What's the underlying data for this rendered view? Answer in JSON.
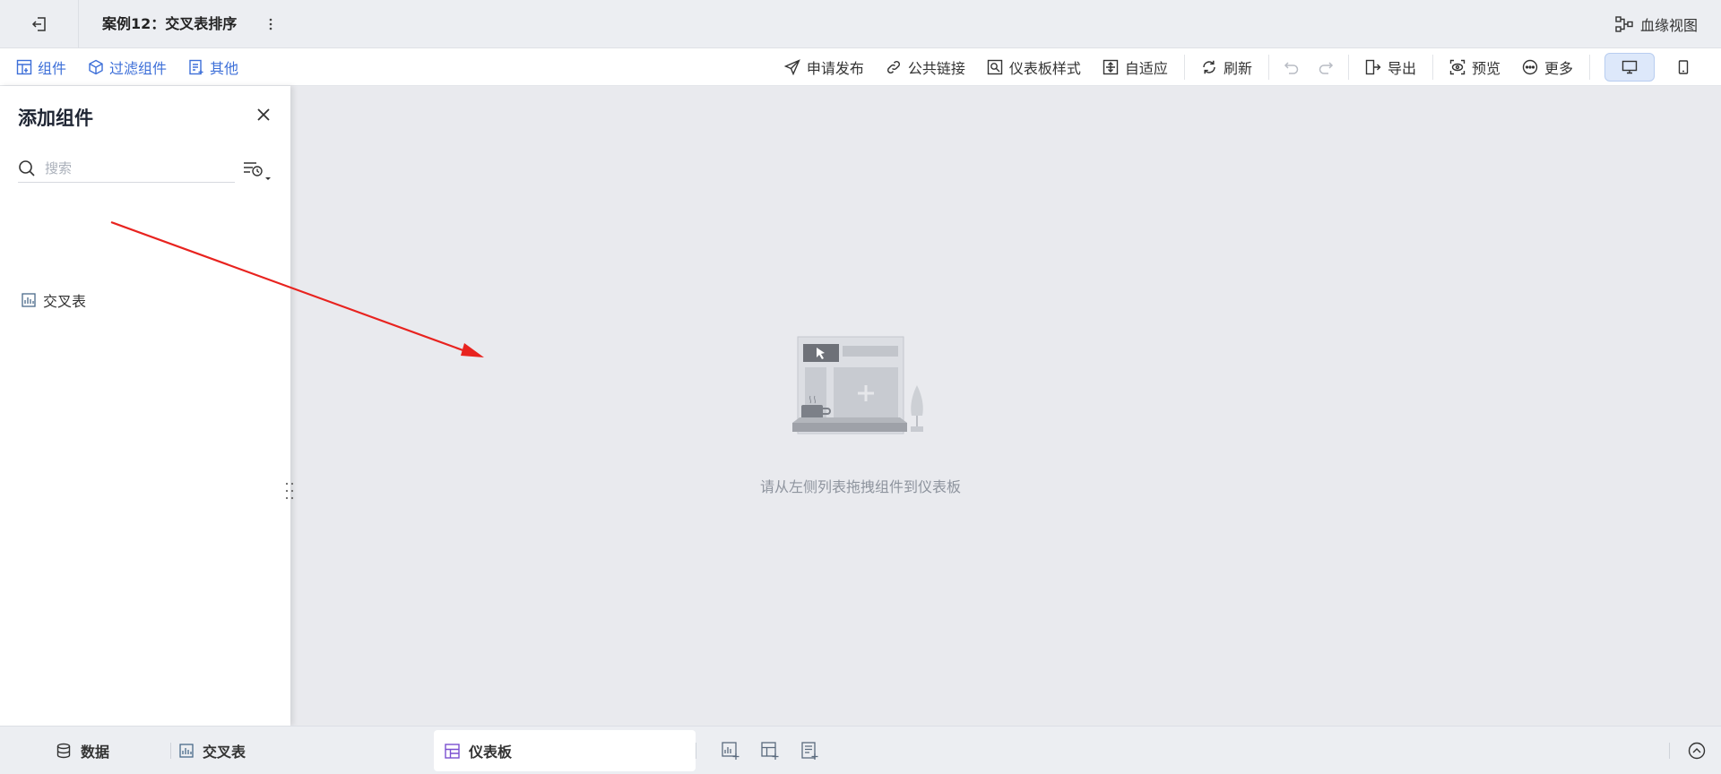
{
  "titlebar": {
    "title": "案例12：交叉表排序",
    "lineage_label": "血缘视图"
  },
  "toolbar": {
    "left_items": [
      "组件",
      "过滤组件",
      "其他"
    ],
    "publish": "申请发布",
    "public_link": "公共链接",
    "dashboard_style": "仪表板样式",
    "adaptive": "自适应",
    "refresh": "刷新",
    "export": "导出",
    "preview": "预览",
    "more": "更多"
  },
  "panel": {
    "title": "添加组件",
    "search_placeholder": "搜索",
    "items": [
      "交叉表"
    ]
  },
  "canvas": {
    "empty_text": "请从左侧列表拖拽组件到仪表板"
  },
  "bottombar": {
    "data_tab": "数据",
    "crosstab_tab": "交叉表",
    "dashboard_tab": "仪表板"
  },
  "colors": {
    "accent": "#3d6fd8",
    "arrow": "#e8231f",
    "canvas_bg": "#e9eaee"
  },
  "icons": [
    "exit-icon",
    "kebab-icon",
    "lineage-icon",
    "component-icon",
    "filter-component-icon",
    "other-icon",
    "send-icon",
    "link-icon",
    "style-icon",
    "adaptive-icon",
    "refresh-icon",
    "undo-icon",
    "redo-icon",
    "export-icon",
    "preview-icon",
    "more-icon",
    "desktop-icon",
    "mobile-icon",
    "close-icon",
    "search-icon",
    "sort-filter-icon",
    "crosstab-icon",
    "database-icon",
    "dashboard-icon",
    "add-crosstab-icon",
    "add-dashboard-icon",
    "add-story-icon",
    "collapse-up-icon"
  ]
}
